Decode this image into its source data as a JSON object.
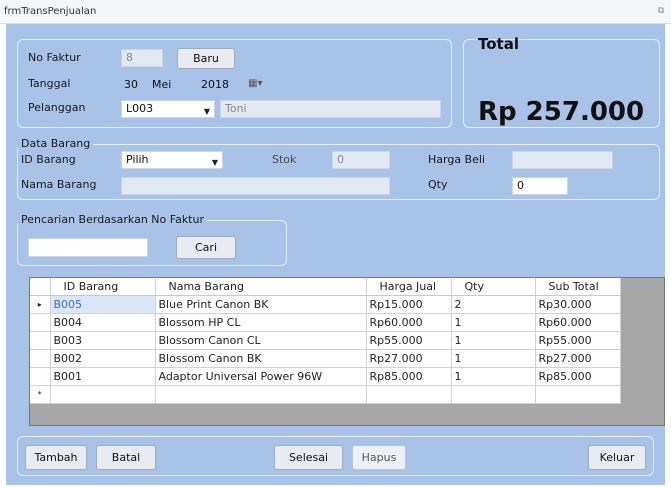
{
  "window": {
    "title": "frmTransPenjualan"
  },
  "header": {
    "no_faktur_label": "No Faktur",
    "no_faktur_value": "8",
    "baru_button": "Baru",
    "tanggal_label": "Tanggal",
    "tanggal_day": "30",
    "tanggal_month": "Mei",
    "tanggal_year": "2018",
    "pelanggan_label": "Pelanggan",
    "pelanggan_code": "L003",
    "pelanggan_name": "Toni"
  },
  "total": {
    "title": "Total",
    "value": "Rp 257.000"
  },
  "data_barang": {
    "legend": "Data Barang",
    "id_barang_label": "ID Barang",
    "id_barang_value": "Pilih",
    "stok_label": "Stok",
    "stok_value": "0",
    "harga_beli_label": "Harga Beli",
    "harga_beli_value": "",
    "nama_barang_label": "Nama Barang",
    "nama_barang_value": "",
    "qty_label": "Qty",
    "qty_value": "0"
  },
  "pencarian": {
    "legend": "Pencarian Berdasarkan No Faktur",
    "input_value": "",
    "cari_button": "Cari"
  },
  "grid": {
    "columns": [
      "ID Barang",
      "Nama Barang",
      "Harga Jual",
      "Qty",
      "Sub Total"
    ],
    "rows": [
      [
        "B005",
        "Blue Print Canon BK",
        "Rp15.000",
        "2",
        "Rp30.000"
      ],
      [
        "B004",
        "Blossom HP CL",
        "Rp60.000",
        "1",
        "Rp60.000"
      ],
      [
        "B003",
        "Blossom Canon CL",
        "Rp55.000",
        "1",
        "Rp55.000"
      ],
      [
        "B002",
        "Blossom Canon BK",
        "Rp27.000",
        "1",
        "Rp27.000"
      ],
      [
        "B001",
        "Adaptor Universal Power 96W",
        "Rp85.000",
        "1",
        "Rp85.000"
      ]
    ],
    "new_row_marker": "*",
    "current_row_marker": "▸"
  },
  "actions": {
    "tambah": "Tambah",
    "batal": "Batal",
    "selesai": "Selesai",
    "hapus": "Hapus",
    "keluar": "Keluar"
  },
  "icons": {
    "calendar": "calendar-icon",
    "dropdown": "chevron-down-icon"
  }
}
